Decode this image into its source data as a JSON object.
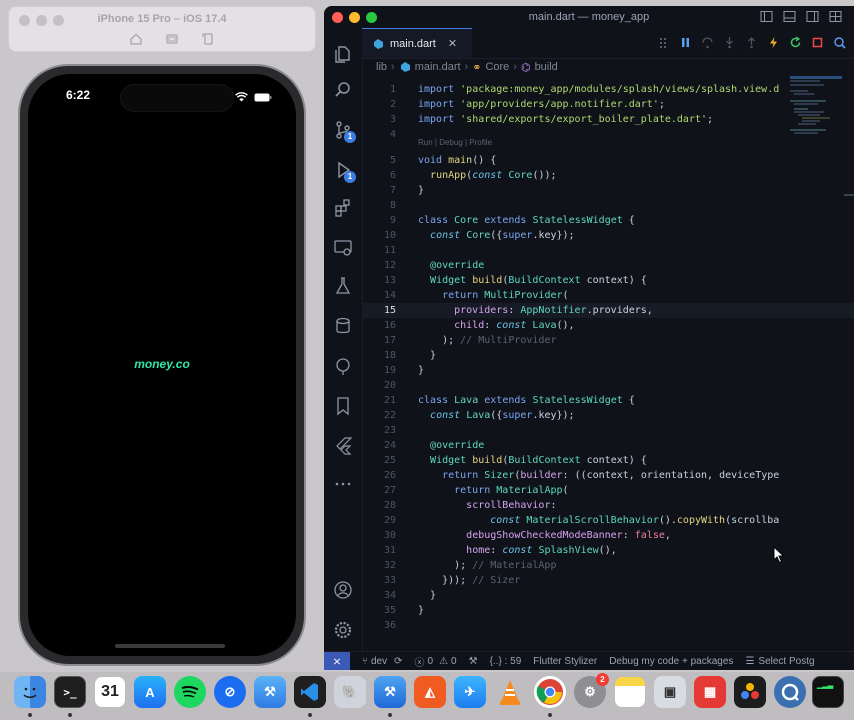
{
  "simulator": {
    "title": "iPhone 15 Pro – iOS 17.4",
    "status_time": "6:22",
    "app_logo_text": "money.co"
  },
  "vscode": {
    "window_title": "main.dart — money_app",
    "tab_label": "main.dart",
    "breadcrumb": [
      "lib",
      "main.dart",
      "Core",
      "build"
    ],
    "codelens": "Run | Debug | Profile",
    "git_badge": "1",
    "debug_badge": "1"
  },
  "code_lines": [
    {
      "n": "1",
      "html": "<span class='k'>import</span> <span class='s'>'package:money_app/modules/splash/views/splash.view.d</span>"
    },
    {
      "n": "2",
      "html": "<span class='k'>import</span> <span class='s'>'app/providers/app.notifier.dart'</span>;"
    },
    {
      "n": "3",
      "html": "<span class='k'>import</span> <span class='s'>'shared/exports/export_boiler_plate.dart'</span>;"
    },
    {
      "n": "4",
      "html": ""
    },
    {
      "n": "5",
      "html": "<span class='k'>void</span> <span class='f'>main</span>() {"
    },
    {
      "n": "6",
      "html": "  <span class='f'>runApp</span>(<span class='kc'>const</span> <span class='t'>Core</span>());"
    },
    {
      "n": "7",
      "html": "}"
    },
    {
      "n": "8",
      "html": ""
    },
    {
      "n": "9",
      "html": "<span class='k'>class</span> <span class='t'>Core</span> <span class='k'>extends</span> <span class='t'>StatelessWidget</span> {"
    },
    {
      "n": "10",
      "html": "  <span class='kc'>const</span> <span class='t'>Core</span>({<span class='k'>super</span>.key});"
    },
    {
      "n": "11",
      "html": ""
    },
    {
      "n": "12",
      "html": "  <span class='t'>@override</span>"
    },
    {
      "n": "13",
      "html": "  <span class='t'>Widget</span> <span class='f'>build</span>(<span class='t'>BuildContext</span> context) {"
    },
    {
      "n": "14",
      "html": "    <span class='k'>return</span> <span class='t'>MultiProvider</span>("
    },
    {
      "n": "15",
      "html": "      <span class='p'>providers</span>: <span class='t'>AppNotifier</span>.providers,",
      "active": true
    },
    {
      "n": "16",
      "html": "      <span class='p'>child</span>: <span class='kc'>const</span> <span class='t'>Lava</span>(),"
    },
    {
      "n": "17",
      "html": "    ); <span class='c'>// MultiProvider</span>"
    },
    {
      "n": "18",
      "html": "  }"
    },
    {
      "n": "19",
      "html": "}"
    },
    {
      "n": "20",
      "html": ""
    },
    {
      "n": "21",
      "html": "<span class='k'>class</span> <span class='t'>Lava</span> <span class='k'>extends</span> <span class='t'>StatelessWidget</span> {"
    },
    {
      "n": "22",
      "html": "  <span class='kc'>const</span> <span class='t'>Lava</span>({<span class='k'>super</span>.key});"
    },
    {
      "n": "23",
      "html": ""
    },
    {
      "n": "24",
      "html": "  <span class='t'>@override</span>"
    },
    {
      "n": "25",
      "html": "  <span class='t'>Widget</span> <span class='f'>build</span>(<span class='t'>BuildContext</span> context) {"
    },
    {
      "n": "26",
      "html": "    <span class='k'>return</span> <span class='t'>Sizer</span>(<span class='p'>builder</span>: ((context, orientation, deviceType"
    },
    {
      "n": "27",
      "html": "      <span class='k'>return</span> <span class='t'>MaterialApp</span>("
    },
    {
      "n": "28",
      "html": "        <span class='p'>scrollBehavior</span>:"
    },
    {
      "n": "29",
      "html": "            <span class='kc'>const</span> <span class='t'>MaterialScrollBehavior</span>().<span class='f'>copyWith</span>(scrollba"
    },
    {
      "n": "30",
      "html": "        <span class='p'>debugShowCheckedModeBanner</span>: <span class='bool'>false</span>,"
    },
    {
      "n": "31",
      "html": "        <span class='p'>home</span>: <span class='kc'>const</span> <span class='t'>SplashView</span>(),"
    },
    {
      "n": "32",
      "html": "      ); <span class='c'>// MaterialApp</span>"
    },
    {
      "n": "33",
      "html": "    })); <span class='c'>// Sizer</span>"
    },
    {
      "n": "34",
      "html": "  }"
    },
    {
      "n": "35",
      "html": "}"
    },
    {
      "n": "36",
      "html": ""
    }
  ],
  "statusbar": {
    "branch": "dev",
    "errors": "0",
    "warnings": "0",
    "symbols": "{..} : 59",
    "formatter": "Flutter Stylizer",
    "debug_mode": "Debug my code + packages",
    "select": "Select Postg"
  },
  "dock": {
    "calendar_day": "31",
    "settings_badge": "2"
  },
  "colors": {
    "editor_bg": "#0f1219",
    "accent": "#3b7de0",
    "logo_green": "#2fe6a5"
  }
}
